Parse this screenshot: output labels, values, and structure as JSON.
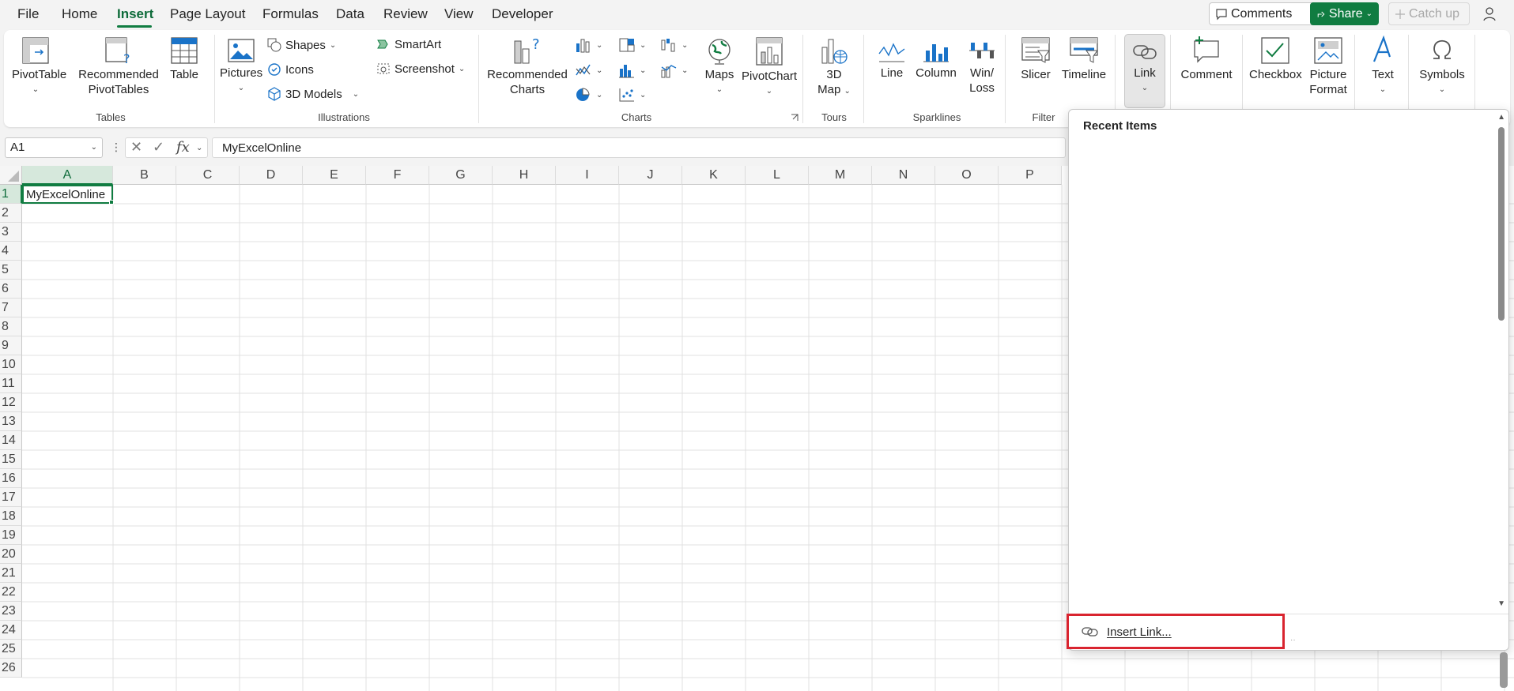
{
  "menu": {
    "items": [
      "File",
      "Home",
      "Insert",
      "Page Layout",
      "Formulas",
      "Data",
      "Review",
      "View",
      "Developer"
    ],
    "active": "Insert"
  },
  "topbar": {
    "comments": "Comments",
    "share": "Share",
    "catch_up": "Catch up"
  },
  "ribbon": {
    "tables": {
      "label": "Tables",
      "pivot_table": "PivotTable",
      "recommended_pivot_1": "Recommended",
      "recommended_pivot_2": "PivotTables",
      "table": "Table"
    },
    "illustrations": {
      "label": "Illustrations",
      "pictures": "Pictures",
      "shapes": "Shapes",
      "icons": "Icons",
      "models_3d": "3D Models",
      "smartart": "SmartArt",
      "screenshot": "Screenshot"
    },
    "charts": {
      "label": "Charts",
      "recommended_1": "Recommended",
      "recommended_2": "Charts",
      "maps": "Maps",
      "pivot_chart": "PivotChart"
    },
    "tours": {
      "label": "Tours",
      "map_3d_1": "3D",
      "map_3d_2": "Map"
    },
    "sparklines": {
      "label": "Sparklines",
      "line": "Line",
      "column": "Column",
      "winloss_1": "Win/",
      "winloss_2": "Loss"
    },
    "filters": {
      "label": "Filter",
      "slicer": "Slicer",
      "timeline": "Timeline"
    },
    "link": "Link",
    "comment": "Comment",
    "checkbox": "Checkbox",
    "picture_format_1": "Picture",
    "picture_format_2": "Format",
    "text": "Text",
    "symbols": "Symbols"
  },
  "formula_bar": {
    "name_box": "A1",
    "fx": "fx",
    "content": "MyExcelOnline"
  },
  "grid": {
    "columns": [
      "A",
      "B",
      "C",
      "D",
      "E",
      "F",
      "G",
      "H",
      "I",
      "J",
      "K",
      "L",
      "M",
      "N",
      "O",
      "P"
    ],
    "rows": [
      "1",
      "2",
      "3",
      "4",
      "5",
      "6",
      "7",
      "8",
      "9",
      "10",
      "11",
      "12",
      "13",
      "14",
      "15",
      "16",
      "17",
      "18",
      "19",
      "20",
      "21",
      "22",
      "23",
      "24",
      "25",
      "26"
    ],
    "active_cell_value": "MyExcelOnline"
  },
  "link_panel": {
    "title": "Recent Items",
    "insert_link": "Insert Link..."
  },
  "colors": {
    "accent": "#107c41",
    "highlight": "#d9242f"
  }
}
